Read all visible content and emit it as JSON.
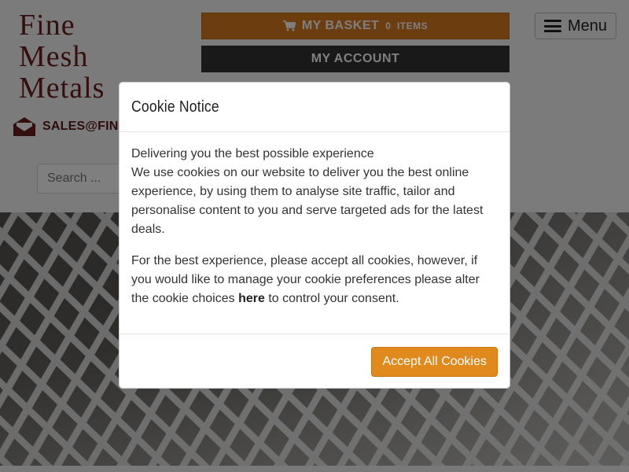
{
  "header": {
    "logo": {
      "line1": "Fine",
      "line2": "Mesh",
      "line3": "Metals"
    },
    "email": "SALES@FINEME",
    "search": {
      "placeholder": "Search ..."
    },
    "basket": {
      "label": "MY BASKET",
      "count": "0",
      "unit": "ITEMS"
    },
    "account": {
      "label": "MY ACCOUNT"
    },
    "menu": {
      "label": "Menu"
    }
  },
  "cookie_modal": {
    "title": "Cookie Notice",
    "para1_line1": "Delivering you the best possible experience",
    "para1_body": "We use cookies on our website to deliver you the best online experience, by using them to analyse site traffic, tailor and personalise content to you and serve targeted ads for the latest deals.",
    "para2_before": "For the best experience, please accept all cookies, however, if you would like to manage your cookie preferences please alter the cookie choices ",
    "para2_link": "here",
    "para2_after": " to control your consent.",
    "accept_label": "Accept All Cookies"
  },
  "colors": {
    "brand_maroon": "#6b1d1d",
    "basket_orange": "#d97a1c",
    "account_dark": "#333333",
    "accept_orange": "#e08a1e"
  },
  "icons": {
    "basket": "shopping-cart-icon",
    "email": "envelope-icon",
    "menu": "hamburger-icon"
  }
}
